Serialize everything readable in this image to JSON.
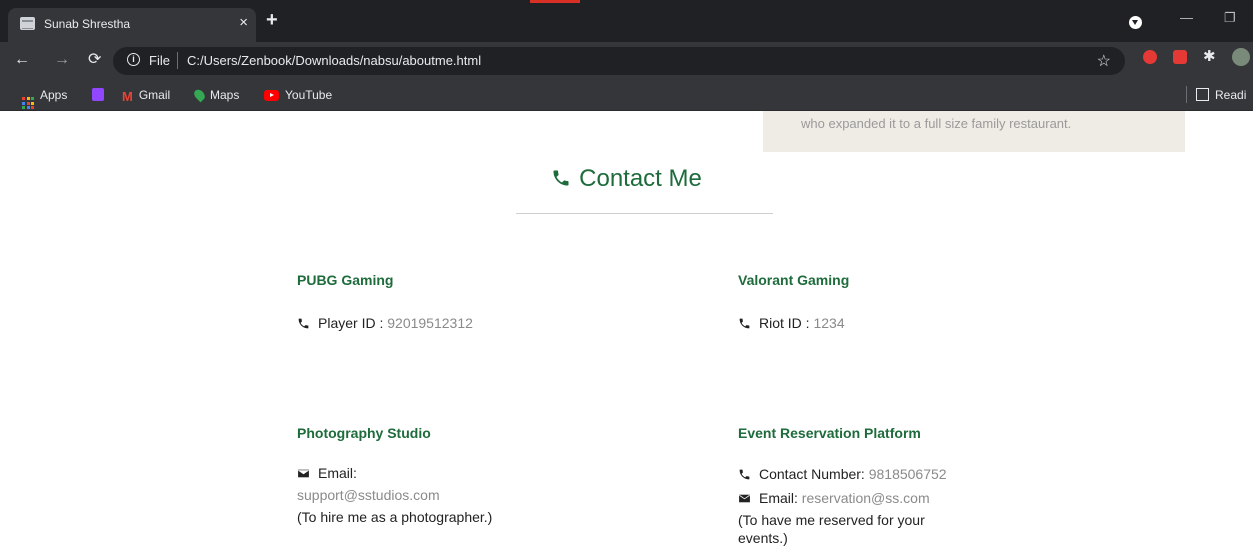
{
  "browser": {
    "tab_title": "Sunab Shrestha",
    "tab_close": "×",
    "new_tab": "+",
    "address_scheme": "File",
    "address_url": "C:/Users/Zenbook/Downloads/nabsu/aboutme.html",
    "bookmarks": [
      "Apps",
      "Gmail",
      "Maps",
      "YouTube"
    ],
    "reading_list": "Readi"
  },
  "page": {
    "story_text": "who expanded it to a full size family restaurant.",
    "contact_title": "Contact Me",
    "pubg": {
      "heading": "PUBG Gaming",
      "label": "Player ID :",
      "value": "92019512312"
    },
    "valorant": {
      "heading": "Valorant Gaming",
      "label": "Riot ID :",
      "value": "1234"
    },
    "photo": {
      "heading": "Photography Studio",
      "email_label": "Email:",
      "email_value": "support@sstudios.com",
      "note": "(To hire me as a photographer.)"
    },
    "event": {
      "heading": "Event Reservation Platform",
      "phone_label": "Contact Number:",
      "phone_value": "9818506752",
      "email_label": "Email:",
      "email_value": "reservation@ss.com",
      "note_line1": "(To have me reserved for your",
      "note_line2": "events.)"
    }
  },
  "colors": {
    "accent_green": "#1e6b3c",
    "muted_value": "#8a8a8a"
  }
}
